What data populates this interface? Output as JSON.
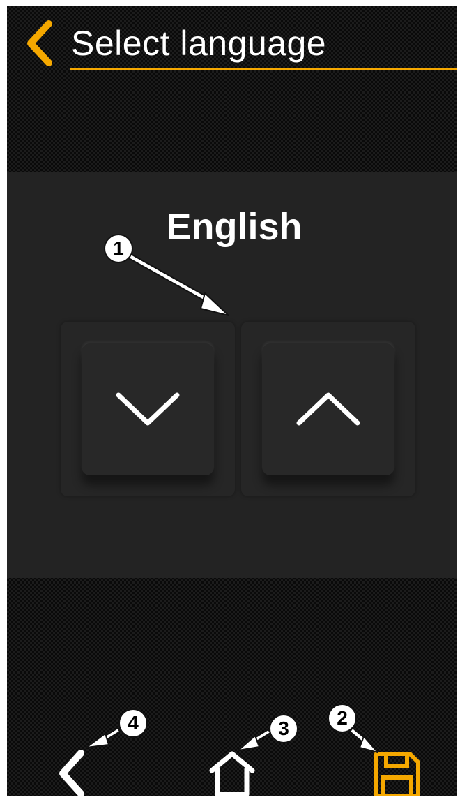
{
  "header": {
    "title": "Select language",
    "back_icon": "chevron-left-icon"
  },
  "language": {
    "current_value": "English",
    "down_icon": "chevron-down-icon",
    "up_icon": "chevron-up-icon"
  },
  "bottom_nav": {
    "back_icon": "chevron-left-icon",
    "home_icon": "home-icon",
    "save_icon": "floppy-disk-save-icon"
  },
  "callouts": [
    "1",
    "2",
    "3",
    "4"
  ],
  "colors": {
    "accent": "#f5a800",
    "panel": "#232323",
    "text": "#ffffff"
  }
}
